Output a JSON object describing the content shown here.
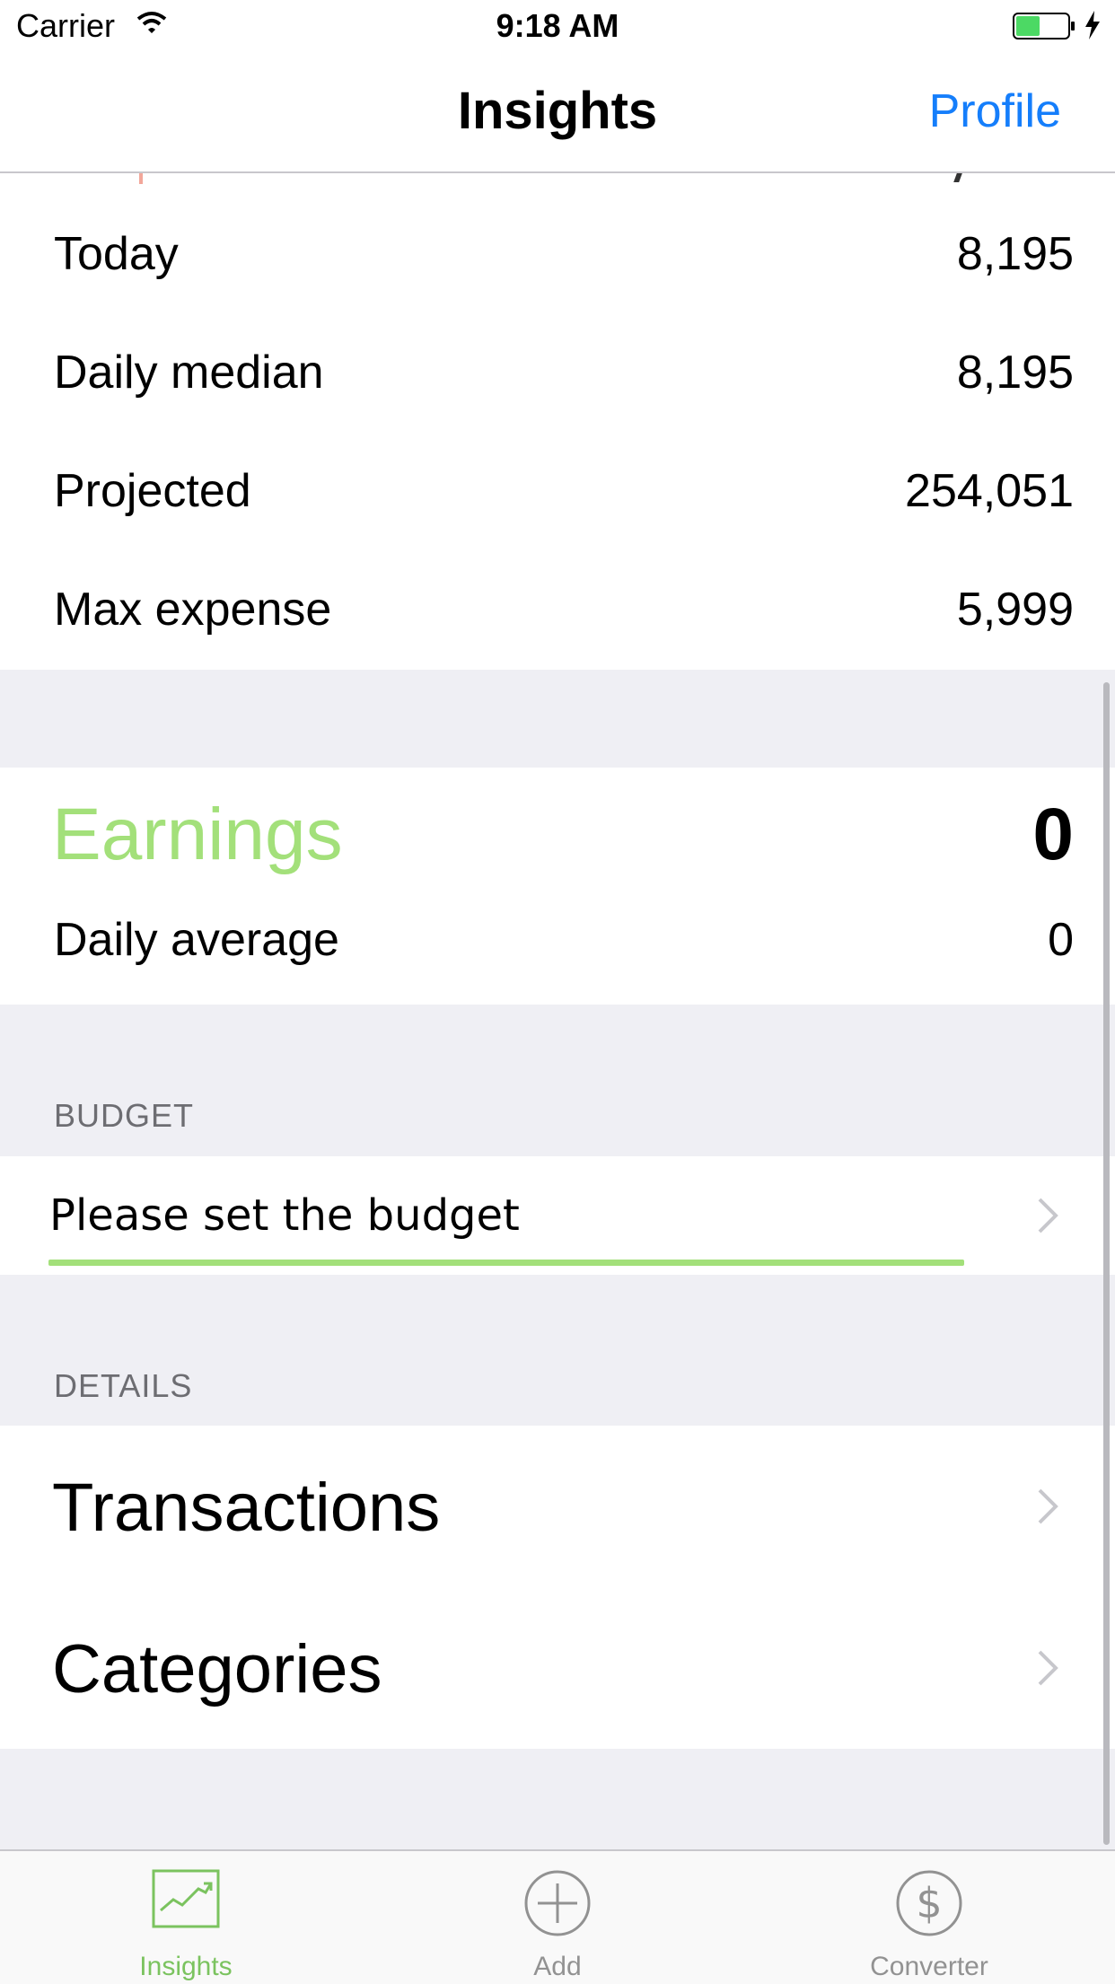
{
  "status_bar": {
    "carrier": "Carrier",
    "time": "9:18 AM"
  },
  "nav": {
    "title": "Insights",
    "profile": "Profile"
  },
  "expense_stats": [
    {
      "label": "Today",
      "value": "8,195"
    },
    {
      "label": "Daily median",
      "value": "8,195"
    },
    {
      "label": "Projected",
      "value": "254,051"
    },
    {
      "label": "Max expense",
      "value": "5,999"
    }
  ],
  "earnings": {
    "title": "Earnings",
    "total": "0",
    "daily_average_label": "Daily average",
    "daily_average_value": "0"
  },
  "budget": {
    "header": "BUDGET",
    "label": "Please set the budget"
  },
  "details": {
    "header": "DETAILS",
    "items": [
      {
        "label": "Transactions"
      },
      {
        "label": "Categories"
      }
    ]
  },
  "tabs": [
    {
      "label": "Insights",
      "icon": "chart-icon",
      "active": true
    },
    {
      "label": "Add",
      "icon": "plus-circle-icon",
      "active": false
    },
    {
      "label": "Converter",
      "icon": "dollar-circle-icon",
      "active": false
    }
  ],
  "colors": {
    "accent_blue": "#157efb",
    "earnings_green": "#a3e07a",
    "tab_active": "#7bc35f",
    "group_background": "#efeff4"
  }
}
